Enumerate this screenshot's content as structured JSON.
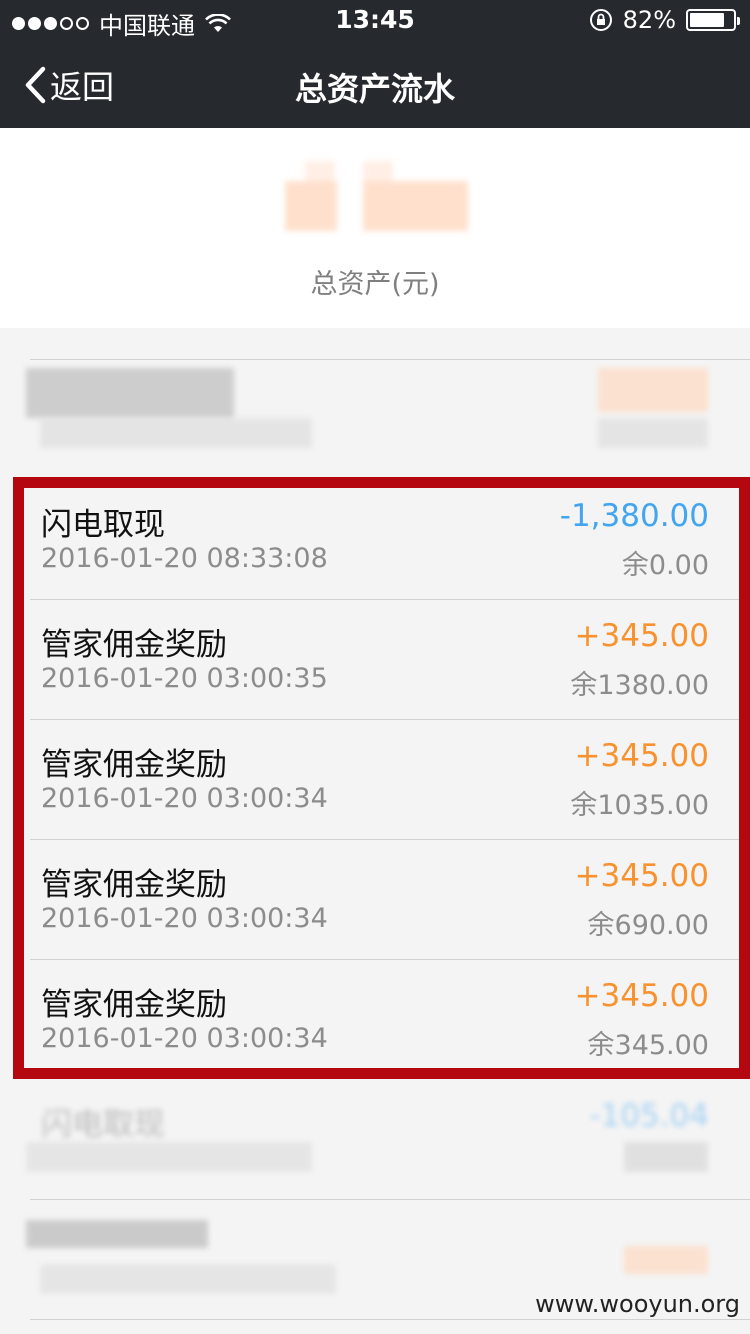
{
  "status_bar": {
    "carrier": "中国联通",
    "time": "13:45",
    "battery_percent": "82%",
    "battery_level": 0.82
  },
  "nav": {
    "back_label": "返回",
    "title": "总资产流水"
  },
  "header": {
    "total_assets_label": "总资产(元)"
  },
  "transactions": [
    {
      "title": "闪电取现",
      "time": "2016-01-20 08:33:08",
      "amount": "-1,380.00",
      "balance": "余0.00",
      "type": "negative"
    },
    {
      "title": "管家佣金奖励",
      "time": "2016-01-20 03:00:35",
      "amount": "+345.00",
      "balance": "余1380.00",
      "type": "positive"
    },
    {
      "title": "管家佣金奖励",
      "time": "2016-01-20 03:00:34",
      "amount": "+345.00",
      "balance": "余1035.00",
      "type": "positive"
    },
    {
      "title": "管家佣金奖励",
      "time": "2016-01-20 03:00:34",
      "amount": "+345.00",
      "balance": "余690.00",
      "type": "positive"
    },
    {
      "title": "管家佣金奖励",
      "time": "2016-01-20 03:00:34",
      "amount": "+345.00",
      "balance": "余345.00",
      "type": "positive"
    }
  ],
  "blurred_rows": [
    {
      "title": "闪电取现",
      "amount": "-105.04"
    }
  ],
  "colors": {
    "navbar": "#262a2e",
    "negative_amount": "#42a5f0",
    "positive_amount": "#f7922e",
    "highlight": "#b5070f"
  },
  "watermark": "www.wooyun.org"
}
